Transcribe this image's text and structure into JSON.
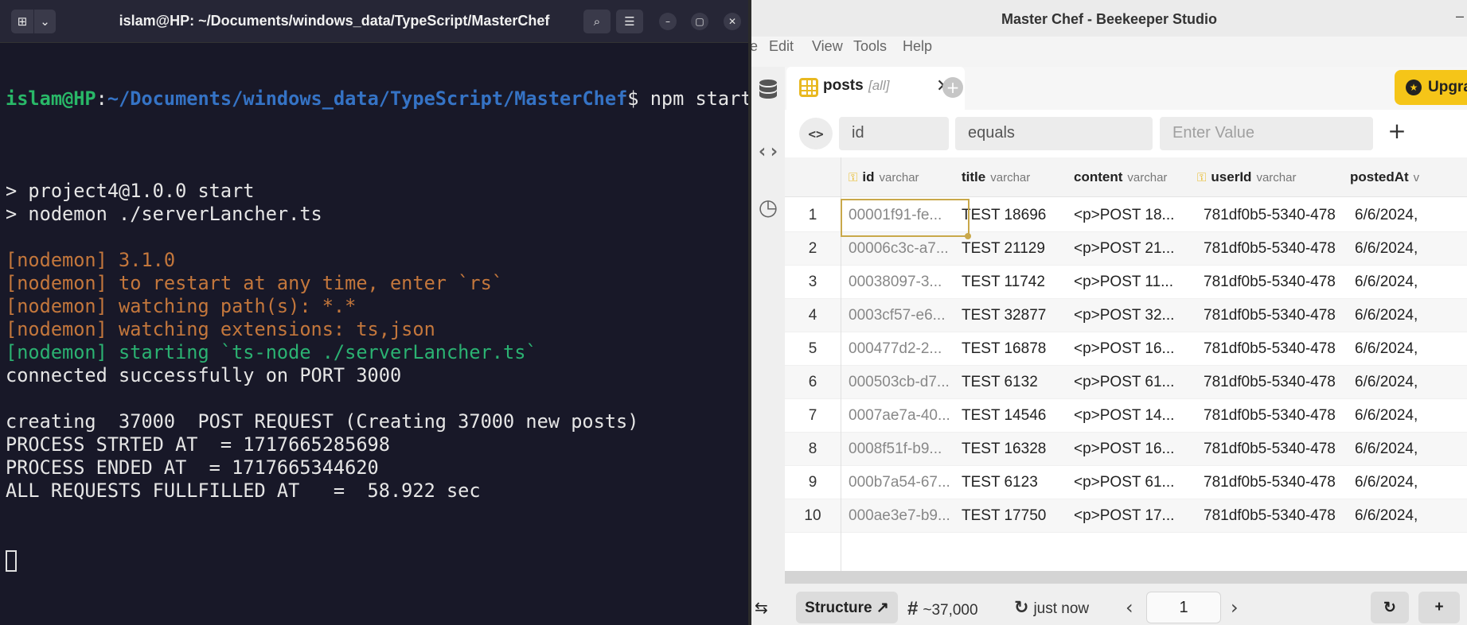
{
  "terminal": {
    "title": "islam@HP: ~/Documents/windows_data/TypeScript/MasterChef",
    "prompt_user": "islam@HP",
    "prompt_sep": ":",
    "prompt_path": "~/Documents/windows_data/TypeScript/MasterChef",
    "prompt_cmd": "$ npm start",
    "lines": [
      {
        "text": "",
        "color": "white"
      },
      {
        "text": "> project4@1.0.0 start",
        "color": "white"
      },
      {
        "text": "> nodemon ./serverLancher.ts",
        "color": "white"
      },
      {
        "text": "",
        "color": "white"
      },
      {
        "text": "[nodemon] 3.1.0",
        "color": "orange"
      },
      {
        "text": "[nodemon] to restart at any time, enter `rs`",
        "color": "orange"
      },
      {
        "text": "[nodemon] watching path(s): *.*",
        "color": "orange"
      },
      {
        "text": "[nodemon] watching extensions: ts,json",
        "color": "orange"
      },
      {
        "text": "[nodemon] starting `ts-node ./serverLancher.ts`",
        "color": "teal"
      },
      {
        "text": "connected successfully on PORT 3000",
        "color": "white"
      },
      {
        "text": "",
        "color": "white"
      },
      {
        "text": "creating  37000  POST REQUEST (Creating 37000 new posts)",
        "color": "white"
      },
      {
        "text": "PROCESS STRTED AT  = 1717665285698",
        "color": "white"
      },
      {
        "text": "PROCESS ENDED AT  = 1717665344620",
        "color": "white"
      },
      {
        "text": "ALL REQUESTS FULLFILLED AT   =  58.922 sec",
        "color": "white"
      }
    ]
  },
  "beekeeper": {
    "window_title": "Master Chef - Beekeeper Studio",
    "menu": [
      "e",
      "Edit",
      "View",
      "Tools",
      "Help"
    ],
    "tab": {
      "label": "posts",
      "suffix": "[all]"
    },
    "upgrade_label": "Upgra",
    "filter": {
      "column": "id",
      "operator": "equals",
      "value_placeholder": "Enter Value"
    },
    "columns": [
      {
        "name": "id",
        "type": "varchar",
        "key": true
      },
      {
        "name": "title",
        "type": "varchar",
        "key": false
      },
      {
        "name": "content",
        "type": "varchar",
        "key": false
      },
      {
        "name": "userId",
        "type": "varchar",
        "key": true
      },
      {
        "name": "postedAt",
        "type": "v",
        "key": false
      }
    ],
    "rows": [
      {
        "num": "1",
        "id": "00001f91-fe...",
        "title": "TEST 18696",
        "content": "<p>POST 18...",
        "userId": "781df0b5-5340-478",
        "postedAt": "6/6/2024,"
      },
      {
        "num": "2",
        "id": "00006c3c-a7...",
        "title": "TEST 21129",
        "content": "<p>POST 21...",
        "userId": "781df0b5-5340-478",
        "postedAt": "6/6/2024,"
      },
      {
        "num": "3",
        "id": "00038097-3...",
        "title": "TEST 11742",
        "content": "<p>POST 11...",
        "userId": "781df0b5-5340-478",
        "postedAt": "6/6/2024,"
      },
      {
        "num": "4",
        "id": "0003cf57-e6...",
        "title": "TEST 32877",
        "content": "<p>POST 32...",
        "userId": "781df0b5-5340-478",
        "postedAt": "6/6/2024,"
      },
      {
        "num": "5",
        "id": "000477d2-2...",
        "title": "TEST 16878",
        "content": "<p>POST 16...",
        "userId": "781df0b5-5340-478",
        "postedAt": "6/6/2024,"
      },
      {
        "num": "6",
        "id": "000503cb-d7...",
        "title": "TEST 6132",
        "content": "<p>POST 61...",
        "userId": "781df0b5-5340-478",
        "postedAt": "6/6/2024,"
      },
      {
        "num": "7",
        "id": "0007ae7a-40...",
        "title": "TEST 14546",
        "content": "<p>POST 14...",
        "userId": "781df0b5-5340-478",
        "postedAt": "6/6/2024,"
      },
      {
        "num": "8",
        "id": "0008f51f-b9...",
        "title": "TEST 16328",
        "content": "<p>POST 16...",
        "userId": "781df0b5-5340-478",
        "postedAt": "6/6/2024,"
      },
      {
        "num": "9",
        "id": "000b7a54-67...",
        "title": "TEST 6123",
        "content": "<p>POST 61...",
        "userId": "781df0b5-5340-478",
        "postedAt": "6/6/2024,"
      },
      {
        "num": "10",
        "id": "000ae3e7-b9...",
        "title": "TEST 17750",
        "content": "<p>POST 17...",
        "userId": "781df0b5-5340-478",
        "postedAt": "6/6/2024,"
      }
    ],
    "status": {
      "structure_label": "Structure ↗",
      "row_count": "~37,000",
      "updated": "just now",
      "page": "1"
    }
  }
}
